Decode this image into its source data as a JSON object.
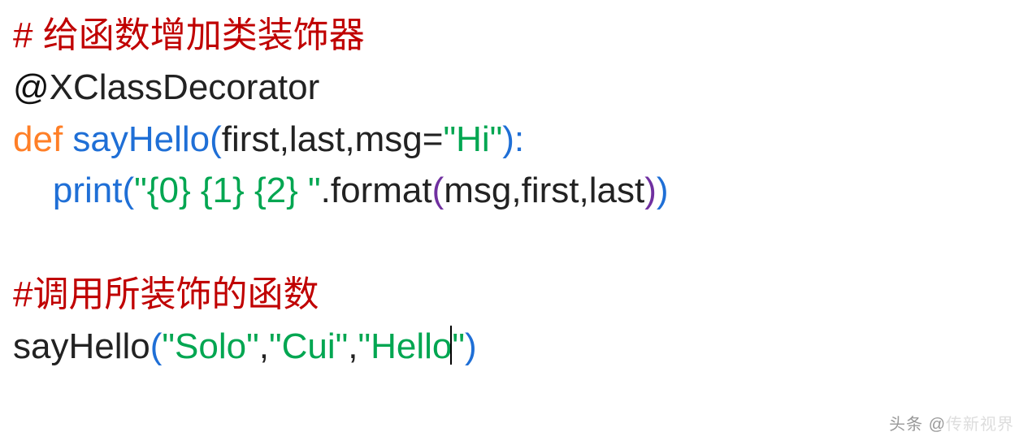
{
  "code": {
    "l1": {
      "hash": "# ",
      "comment_text": "给函数增加类装饰器"
    },
    "l2": {
      "at": "@",
      "decorator": "XClassDecorator"
    },
    "l3": {
      "def": "def ",
      "func": "sayHello",
      "open": "(",
      "p1": "first",
      "c1": ",",
      "p2": "last",
      "c2": ",",
      "p3": "msg",
      "eq": "=",
      "str": "\"Hi\"",
      "close": "):"
    },
    "l4": {
      "indent": "    ",
      "print": "print",
      "open1": "(",
      "str": "\"{0} {1} {2} \"",
      "dot": ".",
      "format": "format",
      "open2": "(",
      "a1": "msg",
      "c1": ",",
      "a2": "first",
      "c2": ",",
      "a3": "last",
      "close2": ")",
      "close1": ")"
    },
    "l6": {
      "hash": "#",
      "comment_text": "调用所装饰的函数"
    },
    "l7": {
      "func": "sayHello",
      "open": "(",
      "s1a": "\"Solo\"",
      "c1": ",",
      "s2a": "\"Cui\"",
      "c2": ",",
      "s3a": "\"Hello",
      "s3b": "\"",
      "close": ")"
    }
  },
  "watermark": {
    "prefix": "头条 ",
    "at": "@",
    "name": "传新视界"
  }
}
